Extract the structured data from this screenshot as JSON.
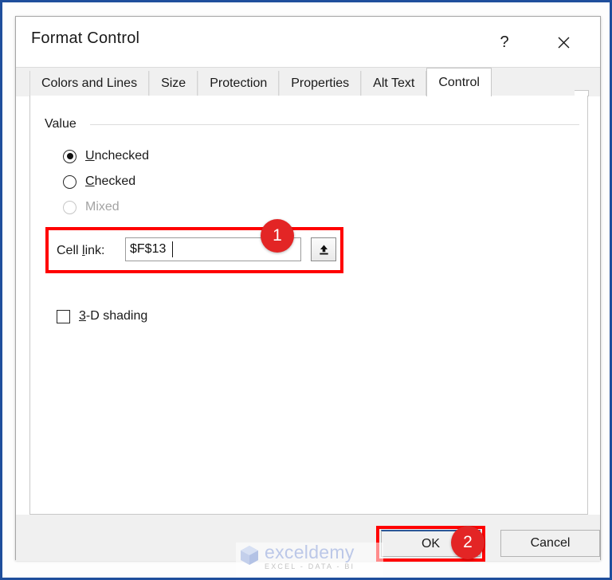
{
  "window": {
    "title": "Format Control",
    "help_icon": "question-mark-icon",
    "close_icon": "close-x-icon"
  },
  "tabs": [
    {
      "label": "Colors and Lines",
      "active": false
    },
    {
      "label": "Size",
      "active": false
    },
    {
      "label": "Protection",
      "active": false
    },
    {
      "label": "Properties",
      "active": false
    },
    {
      "label": "Alt Text",
      "active": false
    },
    {
      "label": "Control",
      "active": true
    }
  ],
  "control_tab": {
    "value_group": {
      "legend": "Value",
      "options": [
        {
          "label": "Unchecked",
          "accelerator": "U",
          "selected": true,
          "disabled": false
        },
        {
          "label": "Checked",
          "accelerator": "C",
          "selected": false,
          "disabled": false
        },
        {
          "label": "Mixed",
          "accelerator": "M",
          "selected": false,
          "disabled": true
        }
      ]
    },
    "cell_link": {
      "label": "Cell link:",
      "accelerator": "l",
      "value": "$F$13",
      "placeholder": "",
      "picker_icon": "collapse-dialog-up-arrow-icon"
    },
    "shading": {
      "label": "3-D shading",
      "accelerator": "3",
      "checked": false
    }
  },
  "footer": {
    "ok_label": "OK",
    "cancel_label": "Cancel"
  },
  "annotations": {
    "badge_1": "1",
    "badge_2": "2",
    "highlight_color": "#ff0000",
    "badge_color": "#e32525"
  },
  "watermark": {
    "name": "exceldemy",
    "tagline": "EXCEL - DATA - BI"
  }
}
